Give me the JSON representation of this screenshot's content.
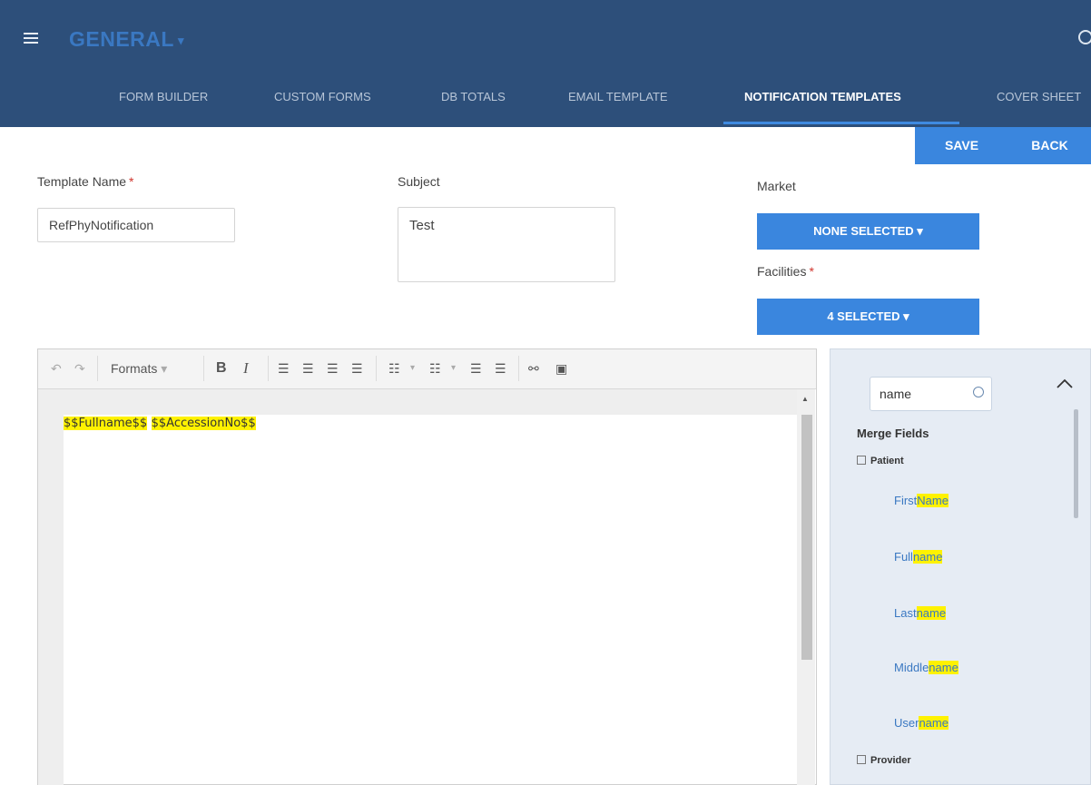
{
  "header": {
    "app_title": "GENERAL",
    "tabs": [
      "FORM BUILDER",
      "CUSTOM FORMS",
      "DB TOTALS",
      "EMAIL TEMPLATE",
      "NOTIFICATION TEMPLATES",
      "COVER SHEET"
    ],
    "active_tab": "NOTIFICATION TEMPLATES"
  },
  "actions": {
    "save": "SAVE",
    "back": "BACK"
  },
  "form": {
    "template_name_label": "Template Name",
    "template_name_value": "RefPhyNotification",
    "subject_label": "Subject",
    "subject_value": "Test",
    "market_label": "Market",
    "market_value": "NONE SELECTED",
    "facilities_label": "Facilities",
    "facilities_value": "4 SELECTED",
    "required_mark": "*"
  },
  "editor": {
    "formats_label": "Formats",
    "content": [
      "$$Fullname$$",
      "$$AccessionNo$$"
    ]
  },
  "merge_panel": {
    "search_value": "name",
    "title": "Merge Fields",
    "groups": [
      {
        "label": "Patient",
        "fields": [
          {
            "prefix": "First",
            "match": "Name"
          },
          {
            "prefix": "Full",
            "match": "name"
          },
          {
            "prefix": "Last",
            "match": "name"
          },
          {
            "prefix": "Middle",
            "match": "name"
          },
          {
            "prefix": "User",
            "match": "name"
          }
        ]
      },
      {
        "label": "Provider",
        "fields": []
      }
    ]
  },
  "colors": {
    "header_bg": "#2d4f7a",
    "accent": "#3a86de",
    "highlight": "#fff200"
  }
}
